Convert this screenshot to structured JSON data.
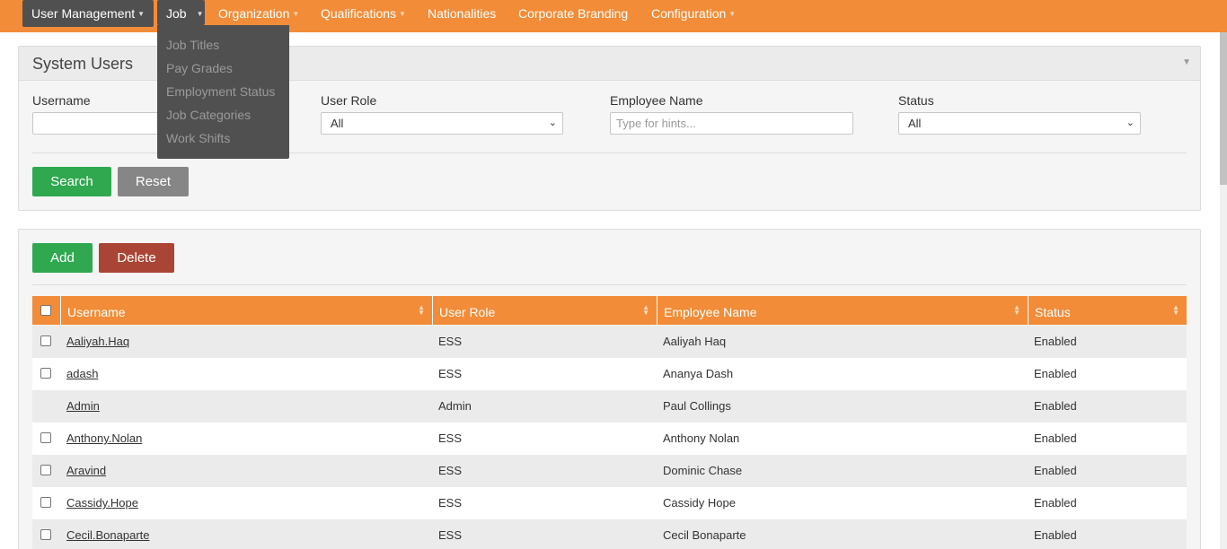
{
  "nav": {
    "items": [
      {
        "label": "User Management",
        "caret": "▼"
      },
      {
        "label": "Job",
        "caret": "▼"
      },
      {
        "label": "Organization",
        "caret": "▼"
      },
      {
        "label": "Qualifications",
        "caret": "▼"
      },
      {
        "label": "Nationalities"
      },
      {
        "label": "Corporate Branding"
      },
      {
        "label": "Configuration",
        "caret": "▼"
      }
    ],
    "job_menu": [
      "Job Titles",
      "Pay Grades",
      "Employment Status",
      "Job Categories",
      "Work Shifts"
    ]
  },
  "filter": {
    "title": "System Users",
    "toggle_icon": "▼",
    "username_label": "Username",
    "username_value": "",
    "user_role_label": "User Role",
    "user_role_value": "All",
    "employee_name_label": "Employee Name",
    "employee_name_placeholder": "Type for hints...",
    "status_label": "Status",
    "status_value": "All",
    "search_label": "Search",
    "reset_label": "Reset"
  },
  "list": {
    "add_label": "Add",
    "delete_label": "Delete",
    "columns": [
      "Username",
      "User Role",
      "Employee Name",
      "Status"
    ],
    "rows": [
      {
        "username": "Aaliyah.Haq",
        "role": "ESS",
        "employee": "Aaliyah Haq",
        "status": "Enabled",
        "checkbox": true
      },
      {
        "username": "adash",
        "role": "ESS",
        "employee": "Ananya Dash",
        "status": "Enabled",
        "checkbox": true
      },
      {
        "username": "Admin",
        "role": "Admin",
        "employee": "Paul Collings",
        "status": "Enabled",
        "checkbox": false
      },
      {
        "username": "Anthony.Nolan",
        "role": "ESS",
        "employee": "Anthony Nolan",
        "status": "Enabled",
        "checkbox": true
      },
      {
        "username": "Aravind",
        "role": "ESS",
        "employee": "Dominic Chase",
        "status": "Enabled",
        "checkbox": true
      },
      {
        "username": "Cassidy.Hope",
        "role": "ESS",
        "employee": "Cassidy Hope",
        "status": "Enabled",
        "checkbox": true
      },
      {
        "username": "Cecil.Bonaparte",
        "role": "ESS",
        "employee": "Cecil Bonaparte",
        "status": "Enabled",
        "checkbox": true
      }
    ]
  },
  "colors": {
    "nav_orange": "#f28c38",
    "nav_dark": "#505050",
    "btn_green": "#2fa84f",
    "btn_gray": "#868686",
    "btn_red": "#aa4535"
  }
}
